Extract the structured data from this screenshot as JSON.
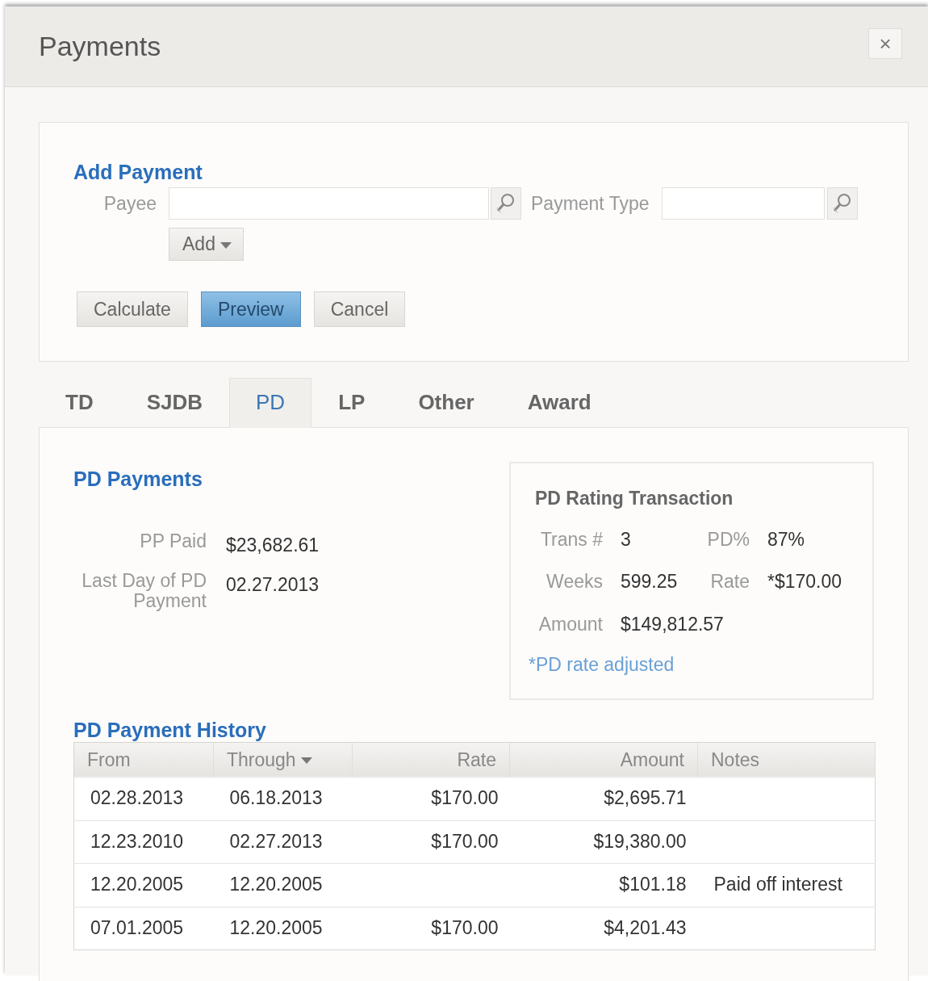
{
  "dialog": {
    "title": "Payments",
    "close": "×"
  },
  "add_payment": {
    "heading": "Add Payment",
    "payee": {
      "label": "Payee"
    },
    "payment_type": {
      "label": "Payment Type"
    },
    "add_button": "Add",
    "buttons": [
      {
        "label": "Calculate",
        "primary": false
      },
      {
        "label": "Preview",
        "primary": true
      },
      {
        "label": "Cancel",
        "primary": false
      }
    ]
  },
  "tabs": [
    {
      "label": "TD",
      "selected": false
    },
    {
      "label": "SJDB",
      "selected": false
    },
    {
      "label": "PD",
      "selected": true
    },
    {
      "label": "LP",
      "selected": false
    },
    {
      "label": "Other",
      "selected": false
    },
    {
      "label": "Award",
      "selected": false
    }
  ],
  "pd_payments": {
    "heading": "PD Payments",
    "fields": [
      {
        "label": "PP Paid",
        "value": "$23,682.61"
      },
      {
        "label": "Last Day of PD Payment",
        "value": "02.27.2013"
      }
    ]
  },
  "rating": {
    "title": "PD Rating Transaction",
    "fields": [
      {
        "label": "Trans #",
        "value": "3"
      },
      {
        "label": "PD%",
        "value": "87%"
      },
      {
        "label": "Weeks",
        "value": "599.25"
      },
      {
        "label": "Rate",
        "value": "*$170.00"
      },
      {
        "label": "Amount",
        "value": "$149,812.57"
      }
    ],
    "note": "*PD rate adjusted"
  },
  "history": {
    "heading": "PD Payment History",
    "columns": [
      {
        "label": "From",
        "sorted": false
      },
      {
        "label": "Through",
        "sorted": true
      },
      {
        "label": "Rate",
        "sorted": false
      },
      {
        "label": "Amount",
        "sorted": false
      },
      {
        "label": "Notes",
        "sorted": false
      }
    ],
    "rows": [
      [
        "02.28.2013",
        "06.18.2013",
        "$170.00",
        "$2,695.71",
        null
      ],
      [
        "12.23.2010",
        "02.27.2013",
        "$170.00",
        "$19,380.00",
        null
      ],
      [
        "12.20.2005",
        "12.20.2005",
        null,
        "$101.18",
        "Paid off interest"
      ],
      [
        "07.01.2005",
        "12.20.2005",
        "$170.00",
        "$4,201.43",
        null
      ]
    ]
  }
}
